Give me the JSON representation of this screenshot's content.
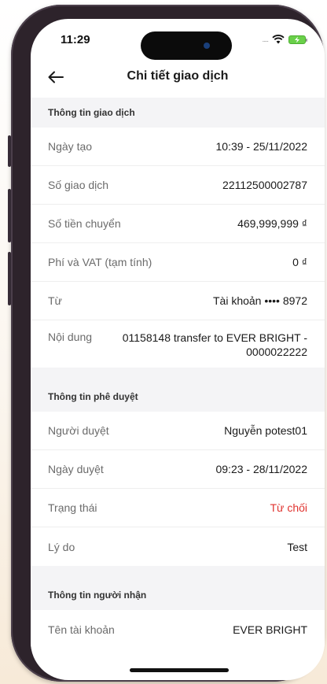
{
  "status": {
    "time": "11:29",
    "signal": "....."
  },
  "header": {
    "title": "Chi tiết giao dịch"
  },
  "sections": {
    "transaction": {
      "title": "Thông tin giao dịch",
      "rows": [
        {
          "label": "Ngày tạo",
          "value": "10:39 - 25/11/2022"
        },
        {
          "label": "Số giao dịch",
          "value": "22112500002787"
        },
        {
          "label": "Số tiền chuyển",
          "value": "469,999,999 ₫"
        },
        {
          "label": "Phí và VAT (tạm tính)",
          "value": "0 ₫"
        },
        {
          "label": "Từ",
          "value": "Tài khoản •••• 8972"
        },
        {
          "label": "Nội dung",
          "value": "01158148 transfer to EVER BRIGHT - 0000022222"
        }
      ]
    },
    "approval": {
      "title": "Thông tin phê duyệt",
      "rows": [
        {
          "label": "Người duyệt",
          "value": "Nguyễn potest01"
        },
        {
          "label": "Ngày duyệt",
          "value": "09:23 - 28/11/2022"
        },
        {
          "label": "Trạng thái",
          "value": "Từ chối"
        },
        {
          "label": "Lý do",
          "value": "Test"
        }
      ]
    },
    "recipient": {
      "title": "Thông tin người nhận",
      "rows": [
        {
          "label": "Tên tài khoản",
          "value": "EVER BRIGHT"
        }
      ]
    }
  },
  "colors": {
    "status_rejected": "#e0332f",
    "section_bg": "#f4f4f6",
    "battery": "#6ad04a"
  },
  "icons": {
    "back": "arrow-left-icon",
    "wifi": "wifi-icon",
    "battery": "battery-charging-icon"
  }
}
